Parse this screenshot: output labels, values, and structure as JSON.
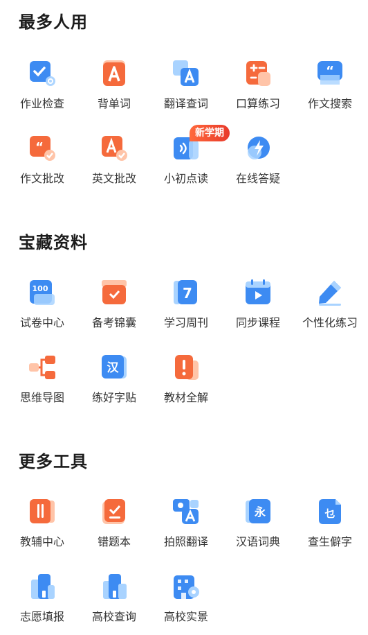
{
  "sections": [
    {
      "title": "最多人用",
      "items": [
        {
          "label": "作业检查",
          "icon": "homework-check-icon"
        },
        {
          "label": "背单词",
          "icon": "word-card-icon"
        },
        {
          "label": "翻译查词",
          "icon": "translate-icon"
        },
        {
          "label": "口算练习",
          "icon": "calculator-icon"
        },
        {
          "label": "作文搜索",
          "icon": "quote-chat-icon"
        },
        {
          "label": "作文批改",
          "icon": "essay-correct-icon"
        },
        {
          "label": "英文批改",
          "icon": "english-correct-icon"
        },
        {
          "label": "小初点读",
          "icon": "audio-read-icon",
          "badge": "新学期"
        },
        {
          "label": "在线答疑",
          "icon": "lightning-chat-icon"
        }
      ]
    },
    {
      "title": "宝藏资料",
      "items": [
        {
          "label": "试卷中心",
          "icon": "exam-100-icon"
        },
        {
          "label": "备考锦囊",
          "icon": "box-check-icon"
        },
        {
          "label": "学习周刊",
          "icon": "weekly-7-icon"
        },
        {
          "label": "同步课程",
          "icon": "calendar-play-icon"
        },
        {
          "label": "个性化练习",
          "icon": "pencil-icon"
        },
        {
          "label": "思维导图",
          "icon": "mindmap-icon"
        },
        {
          "label": "练好字贴",
          "icon": "han-char-icon"
        },
        {
          "label": "教材全解",
          "icon": "exclamation-book-icon"
        }
      ]
    },
    {
      "title": "更多工具",
      "items": [
        {
          "label": "教辅中心",
          "icon": "book-stack-icon"
        },
        {
          "label": "错题本",
          "icon": "wrong-book-icon"
        },
        {
          "label": "拍照翻译",
          "icon": "camera-translate-icon"
        },
        {
          "label": "汉语词典",
          "icon": "yong-dictionary-icon"
        },
        {
          "label": "查生僻字",
          "icon": "rare-char-icon"
        },
        {
          "label": "志愿填报",
          "icon": "building-chart-icon"
        },
        {
          "label": "高校查询",
          "icon": "college-search-icon"
        },
        {
          "label": "高校实景",
          "icon": "college-view-icon"
        }
      ]
    }
  ],
  "colors": {
    "blue": "#3d8bf2",
    "orange": "#f56a3c",
    "light_blue": "#a9d3ff",
    "light_orange": "#ffc4a8"
  }
}
